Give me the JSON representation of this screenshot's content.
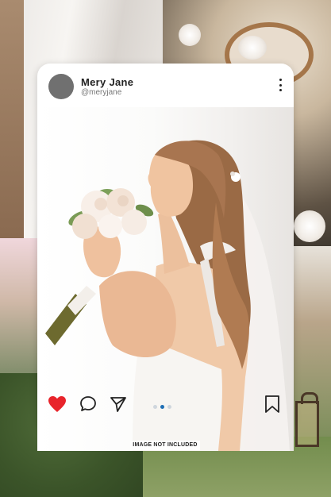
{
  "post": {
    "display_name": "Mery Jane",
    "username": "@meryjane",
    "icons": {
      "more": "more-vertical-icon",
      "like": "heart-icon",
      "comment": "comment-icon",
      "share": "send-icon",
      "save": "bookmark-icon"
    },
    "like_color": "#e8242b",
    "carousel": {
      "total": 3,
      "active": 2
    }
  },
  "disclaimer": "IMAGE NOT INCLUDED"
}
